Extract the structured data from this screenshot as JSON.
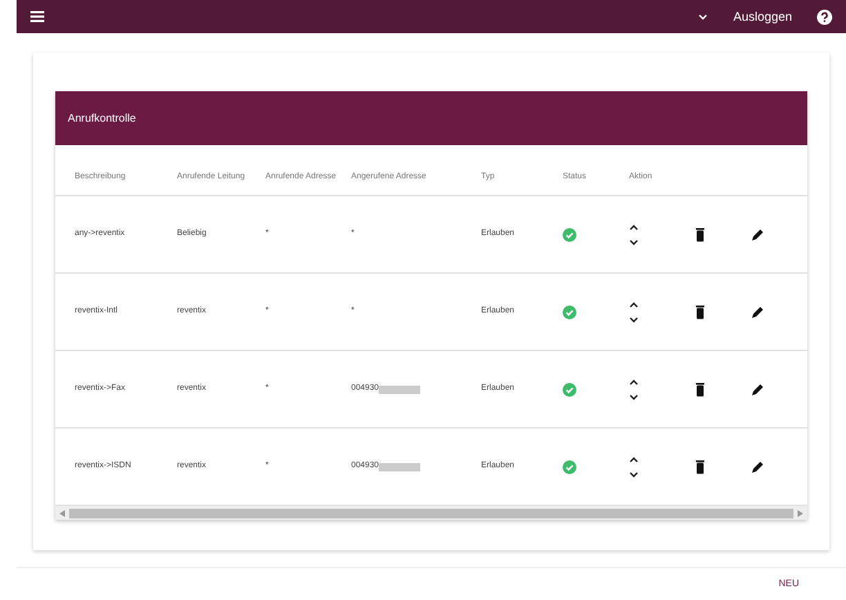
{
  "top_bar": {
    "logout": "Ausloggen"
  },
  "panel": {
    "title": "Anrufkontrolle"
  },
  "table": {
    "columns": [
      "Beschreibung",
      "Anrufende Leitung",
      "Anrufende Adresse",
      "Angerufene Adresse",
      "Typ",
      "Status",
      "Aktion"
    ],
    "rows": [
      {
        "description": "any->reventix",
        "line": "Beliebig",
        "calling": "*",
        "called": "*",
        "called_redacted": false,
        "type": "Erlauben",
        "enabled": true
      },
      {
        "description": "reventix-Intl",
        "line": "reventix",
        "calling": "*",
        "called": "*",
        "called_redacted": false,
        "type": "Erlauben",
        "enabled": true
      },
      {
        "description": "reventix->Fax",
        "line": "reventix",
        "calling": "*",
        "called": "004930",
        "called_redacted": true,
        "type": "Erlauben",
        "enabled": true
      },
      {
        "description": "reventix->ISDN",
        "line": "reventix",
        "calling": "*",
        "called": "004930",
        "called_redacted": true,
        "type": "Erlauben",
        "enabled": true
      }
    ]
  },
  "footer": {
    "new_button": "NEU"
  }
}
